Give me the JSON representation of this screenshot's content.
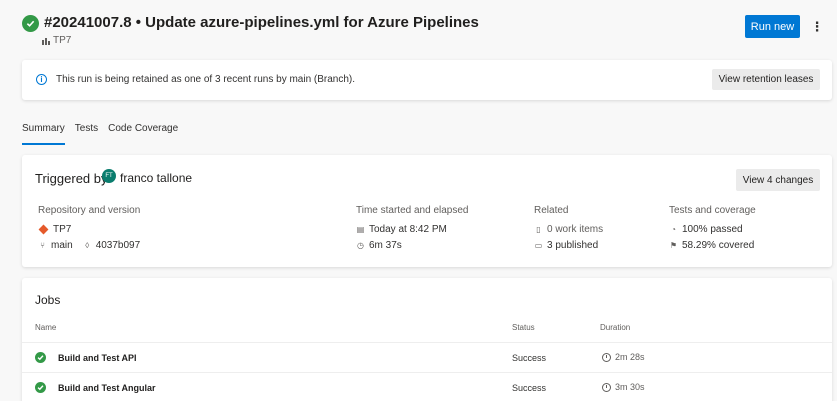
{
  "header": {
    "title": "#20241007.8 • Update azure-pipelines.yml for Azure Pipelines",
    "project": "TP7",
    "run_new_label": "Run new",
    "more_label": "⋮"
  },
  "retention": {
    "message": "This run is being retained as one of 3 recent runs by main (Branch).",
    "button_label": "View retention leases"
  },
  "tabs": [
    {
      "label": "Summary",
      "active": true
    },
    {
      "label": "Tests",
      "active": false
    },
    {
      "label": "Code Coverage",
      "active": false
    }
  ],
  "summary": {
    "triggered_by_label": "Triggered by",
    "user_initials": "FT",
    "user_name": "franco tallone",
    "view_changes_label": "View 4 changes",
    "repo": {
      "heading": "Repository and version",
      "name": "TP7",
      "branch": "main",
      "commit": "4037b097"
    },
    "time": {
      "heading": "Time started and elapsed",
      "started": "Today at 8:42 PM",
      "elapsed": "6m 37s"
    },
    "related": {
      "heading": "Related",
      "work_items": "0 work items",
      "published": "3 published"
    },
    "tests": {
      "heading": "Tests and coverage",
      "passed": "100% passed",
      "covered": "58.29% covered"
    }
  },
  "jobs": {
    "title": "Jobs",
    "columns": {
      "name": "Name",
      "status": "Status",
      "duration": "Duration"
    },
    "rows": [
      {
        "name": "Build and Test API",
        "status": "Success",
        "duration": "2m 28s"
      },
      {
        "name": "Build and Test Angular",
        "status": "Success",
        "duration": "3m 30s"
      }
    ]
  },
  "colors": {
    "accent": "#0078d4",
    "success": "#339947",
    "avatar": "#0a7d6e",
    "repo_icon": "#e55a2b"
  }
}
